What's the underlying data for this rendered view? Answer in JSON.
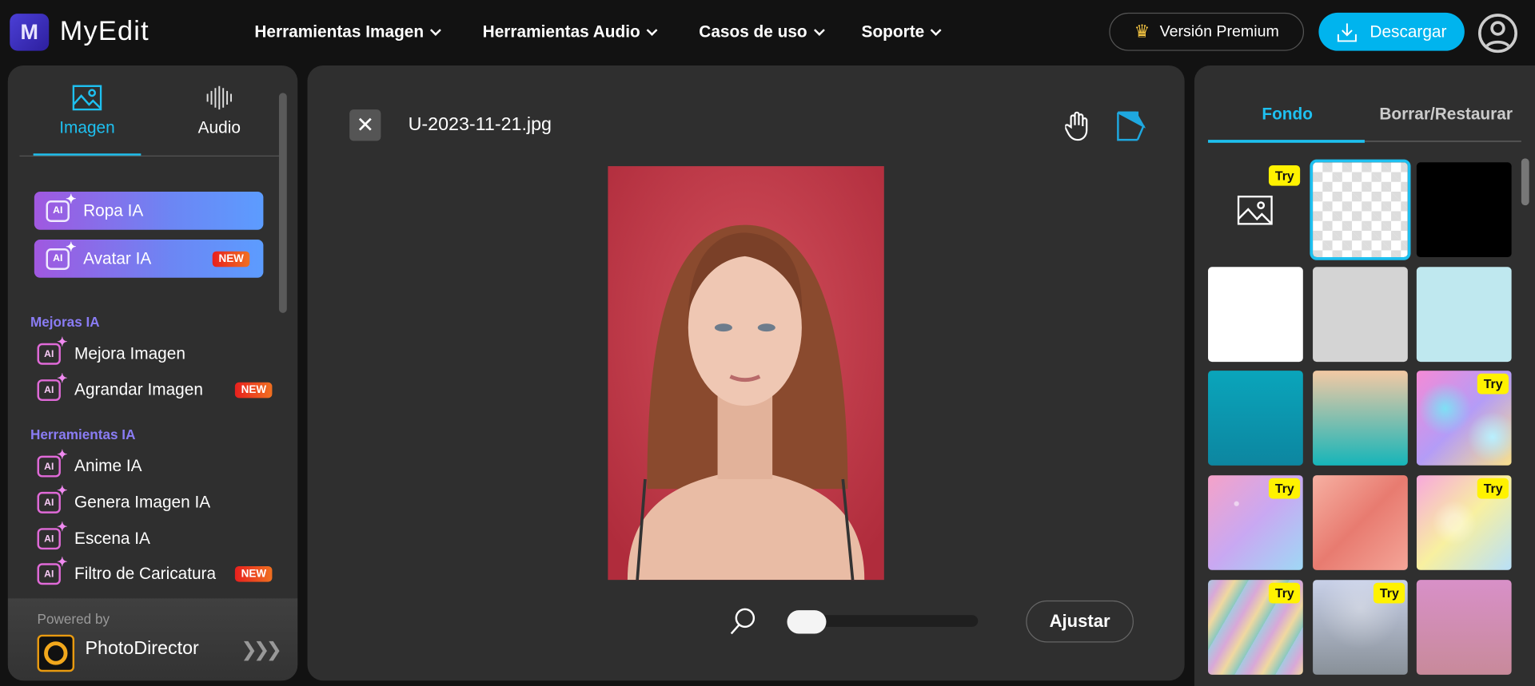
{
  "header": {
    "brand": "MyEdit",
    "logo_letter": "M",
    "nav": [
      "Herramientas Imagen",
      "Herramientas Audio",
      "Casos de uso",
      "Soporte"
    ],
    "premium": "Versión Premium",
    "download": "Descargar"
  },
  "left": {
    "tabs": [
      "Imagen",
      "Audio"
    ],
    "featured": [
      {
        "label": "Ropa IA"
      },
      {
        "label": "Avatar IA",
        "badge": "NEW"
      }
    ],
    "sections": [
      {
        "title": "Mejoras IA",
        "items": [
          {
            "label": "Mejora Imagen"
          },
          {
            "label": "Agrandar Imagen",
            "badge": "NEW"
          }
        ]
      },
      {
        "title": "Herramientas IA",
        "items": [
          {
            "label": "Anime IA"
          },
          {
            "label": "Genera Imagen IA"
          },
          {
            "label": "Escena IA"
          },
          {
            "label": "Filtro de Caricatura",
            "badge": "NEW"
          }
        ]
      }
    ],
    "powered_by": "Powered by",
    "product": "PhotoDirector"
  },
  "editor": {
    "filename": "U-2023-11-21.jpg",
    "fit": "Ajustar",
    "zoom_fraction": 0
  },
  "right": {
    "tabs": [
      "Fondo",
      "Borrar/Restaurar"
    ],
    "try": "Try"
  },
  "colors": {
    "accent": "#00b4ee",
    "new_badge": "#e8201e",
    "try_badge": "#fff200"
  }
}
